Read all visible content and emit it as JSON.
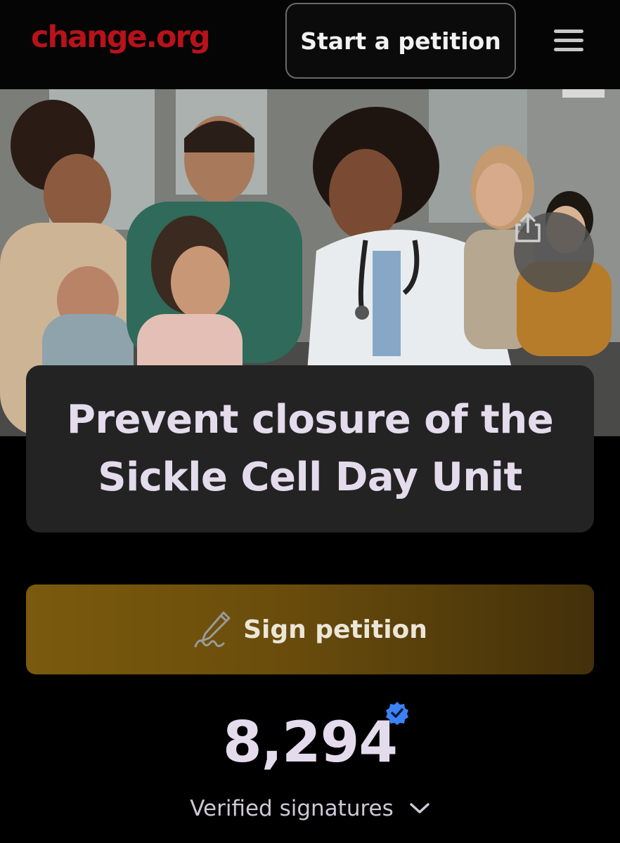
{
  "header": {
    "logo": "change.org",
    "start_petition_label": "Start a petition",
    "menu_icon": "hamburger-menu-icon"
  },
  "hero": {
    "share_icon": "share-icon"
  },
  "petition": {
    "title": "Prevent closure of the Sickle Cell Day Unit"
  },
  "sign": {
    "label": "Sign petition",
    "icon": "pen-signature-icon"
  },
  "signatures": {
    "count": "8,294",
    "label": "Verified signatures",
    "badge_icon": "verified-check-icon",
    "chevron_icon": "chevron-down-icon"
  },
  "colors": {
    "brand": "#b8121a",
    "sign_button": "#7a5a0d",
    "verified_badge": "#3b82f6"
  }
}
